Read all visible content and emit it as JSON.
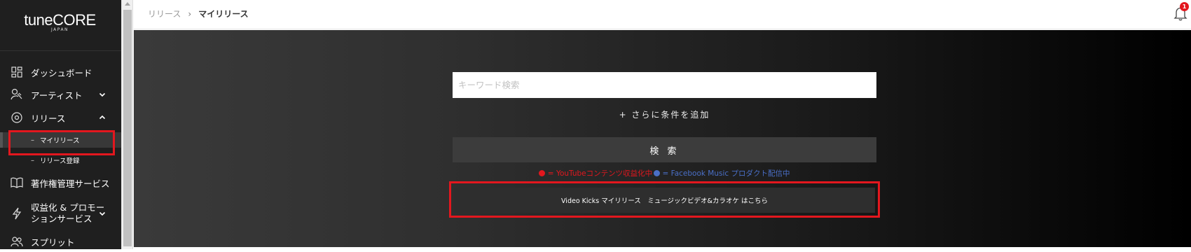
{
  "brand": {
    "logo_main": "tune",
    "logo_core": "CORE",
    "logo_sub": "JAPAN"
  },
  "sidebar": {
    "items": [
      {
        "label": "ダッシュボード",
        "icon": "dashboard-icon"
      },
      {
        "label": "アーティスト",
        "icon": "artist-icon",
        "chevron": "down"
      },
      {
        "label": "リリース",
        "icon": "release-disc-icon",
        "chevron": "up"
      },
      {
        "label": "著作権管理サービス",
        "icon": "book-icon"
      },
      {
        "label": "収益化 & プロモーションサービス",
        "label_line1": "収益化 & プロモー",
        "label_line2": "ションサービス",
        "icon": "lightning-icon",
        "chevron": "down"
      },
      {
        "label": "スプリット",
        "icon": "users-icon"
      }
    ],
    "sub_items": [
      {
        "dash": "–",
        "label": "マイリリース",
        "active": true
      },
      {
        "dash": "–",
        "label": "リリース登録",
        "active": false
      }
    ]
  },
  "header": {
    "breadcrumb": {
      "parent": "リリース",
      "separator": "›",
      "current": "マイリリース"
    },
    "notification_count": "1"
  },
  "main": {
    "search": {
      "placeholder": "キーワード検索",
      "value": ""
    },
    "add_condition_label": "+ さらに条件を追加",
    "search_button_label": "検 索",
    "legend": {
      "youtube_text": " = YouTubeコンテンツ収益化中",
      "facebook_text": " = Facebook Music プロダクト配信中",
      "youtube_color": "#e3171e",
      "facebook_color": "#4a6fc7"
    },
    "videokicks_button_label": "Video Kicks マイリリース　ミュージックビデオ&カラオケ はこちら"
  },
  "colors": {
    "sidebar_bg": "#1f1f1f",
    "accent_red": "#e3171e"
  }
}
